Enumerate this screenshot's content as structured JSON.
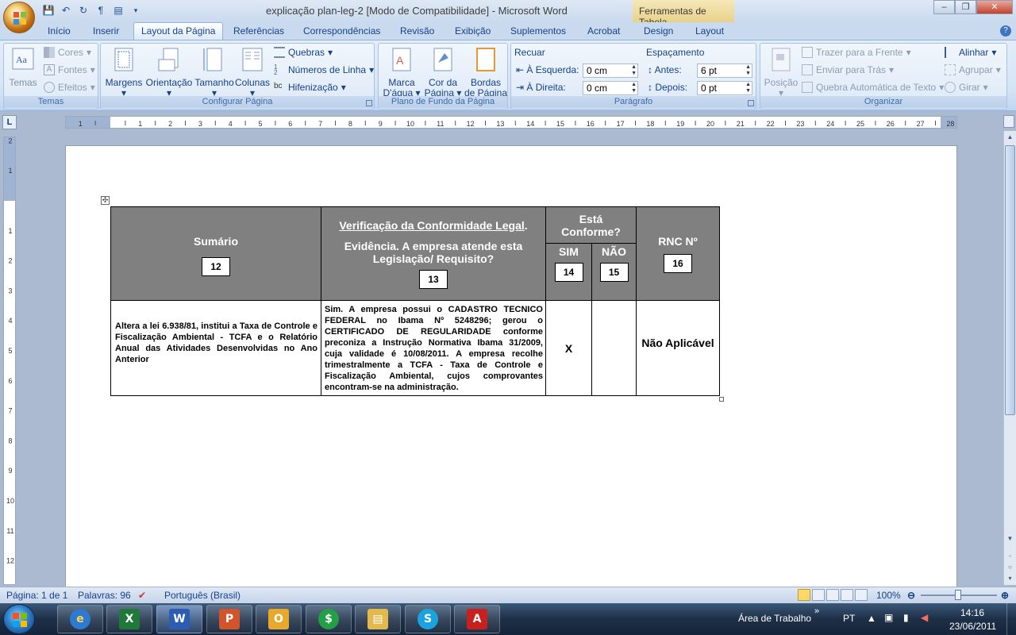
{
  "window": {
    "title": "explicação plan-leg-2 [Modo de Compatibilidade] - Microsoft Word",
    "context_tab_title": "Ferramentas de Tabela",
    "controls": [
      "–",
      "❐",
      "✕"
    ]
  },
  "quick_access": [
    "save-icon",
    "undo-icon",
    "redo-icon",
    "format-icon",
    "print-preview-icon"
  ],
  "tabs": [
    {
      "label": "Início"
    },
    {
      "label": "Inserir"
    },
    {
      "label": "Layout da Página"
    },
    {
      "label": "Referências"
    },
    {
      "label": "Correspondências"
    },
    {
      "label": "Revisão"
    },
    {
      "label": "Exibição"
    },
    {
      "label": "Suplementos"
    },
    {
      "label": "Acrobat"
    },
    {
      "label": "Design"
    },
    {
      "label": "Layout"
    }
  ],
  "ribbon": {
    "temas": {
      "label": "Temas",
      "big": "Temas",
      "cores": "Cores",
      "fontes": "Fontes",
      "efeitos": "Efeitos"
    },
    "config": {
      "label": "Configurar Página",
      "margens": "Margens",
      "orientacao": "Orientação",
      "tamanho": "Tamanho",
      "colunas": "Colunas",
      "quebras": "Quebras",
      "numeros": "Números de Linha",
      "hifenizacao": "Hifenização"
    },
    "fundo": {
      "label": "Plano de Fundo da Página",
      "marca_1": "Marca",
      "marca_2": "D'água",
      "cor_1": "Cor da",
      "cor_2": "Página",
      "bordas_1": "Bordas",
      "bordas_2": "de Página"
    },
    "paragrafo": {
      "label": "Parágrafo",
      "recuar": "Recuar",
      "esquerda": "À Esquerda:",
      "esquerda_val": "0 cm",
      "direita": "À Direita:",
      "direita_val": "0 cm",
      "espacamento": "Espaçamento",
      "antes": "Antes:",
      "antes_val": "6 pt",
      "depois": "Depois:",
      "depois_val": "0 pt"
    },
    "organizar": {
      "label": "Organizar",
      "posicao": "Posição",
      "trazer": "Trazer para a Frente",
      "enviar": "Enviar para Trás",
      "quebra": "Quebra Automática de Texto",
      "alinhar": "Alinhar",
      "agrupar": "Agrupar",
      "girar": "Girar"
    }
  },
  "ruler": {
    "corner": "L"
  },
  "document": {
    "header": {
      "sumario": "Sumário",
      "sumario_num": "12",
      "verif_title": "Verificação da Conformidade Legal",
      "verif_dot": ".",
      "verif_sub": "Evidência. A empresa atende esta Legislação/ Requisito?",
      "verif_num": "13",
      "esta": "Está Conforme?",
      "sim": "SIM",
      "sim_num": "14",
      "nao": "NÃO",
      "nao_num": "15",
      "rnc": "RNC Nº",
      "rnc_num": "16"
    },
    "row": {
      "sumario": "Altera a lei 6.938/81, institui a Taxa de Controle e Fiscalização Ambiental - TCFA e o Relatório Anual das Atividades Desenvolvidas no Ano Anterior",
      "verif": "Sim. A empresa possui o CADASTRO TECNICO FEDERAL no Ibama Nº 5248296; gerou o CERTIFICADO DE REGULARIDADE conforme preconiza a Instrução Normativa Ibama 31/2009, cuja validade é 10/08/2011. A empresa recolhe trimestralmente a TCFA - Taxa de Controle e Fiscalização Ambiental, cujos comprovantes encontram-se na administração.",
      "sim": "X",
      "nao": "",
      "rnc": "Não Aplicável"
    }
  },
  "status": {
    "pagina": "Página: 1 de 1",
    "palavras": "Palavras: 96",
    "idioma": "Português (Brasil)",
    "zoom": "100%"
  },
  "taskbar": {
    "apps": [
      "ie-icon",
      "excel-icon",
      "word-icon",
      "powerpoint-icon",
      "outlook-icon",
      "green-app-icon",
      "explorer-icon",
      "skype-icon",
      "acrobat-icon"
    ],
    "area_trabalho": "Área de Trabalho",
    "lang": "PT",
    "time": "14:16",
    "date": "23/06/2011"
  }
}
